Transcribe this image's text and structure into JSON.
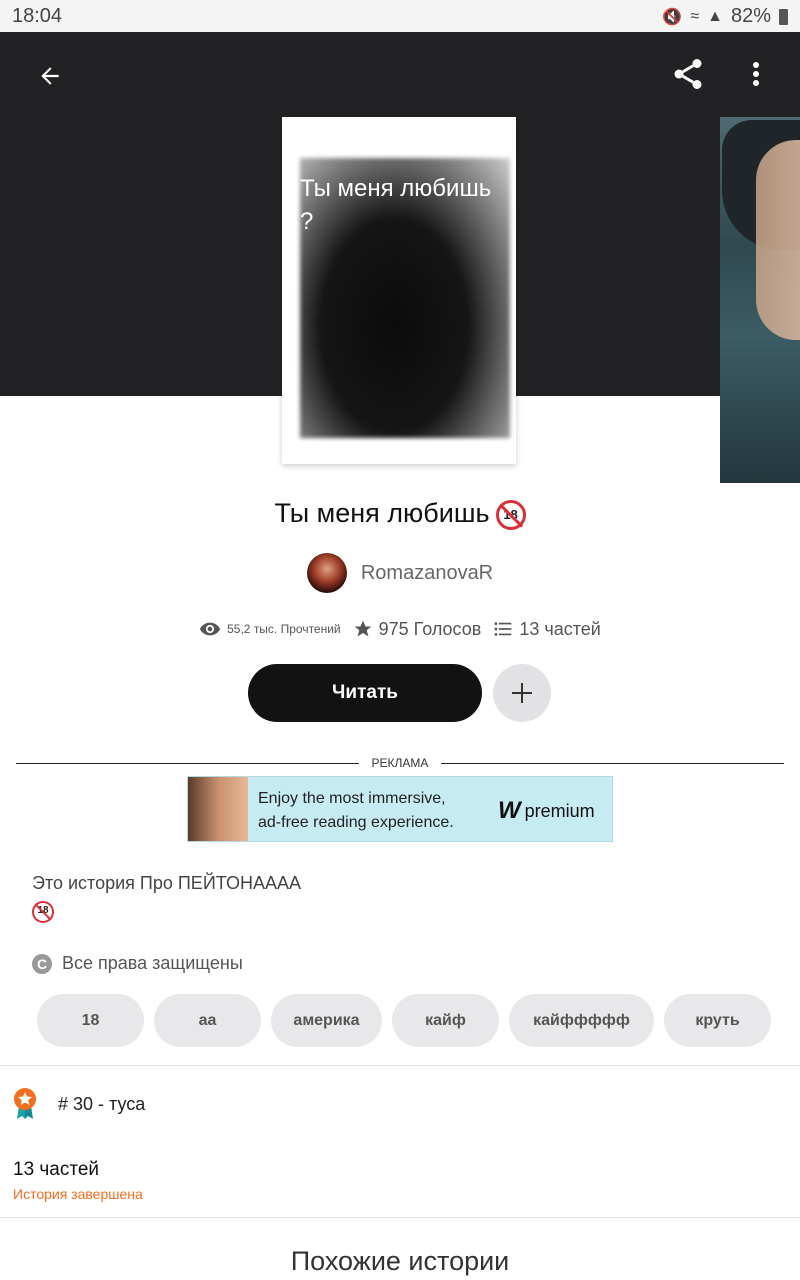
{
  "status_bar": {
    "time": "18:04",
    "battery": "82%"
  },
  "toolbar": {
    "back_icon": "back-arrow-icon",
    "share_icon": "share-icon",
    "more_icon": "more-vert-icon"
  },
  "cover": {
    "text": "Ты меня любишь ?"
  },
  "story": {
    "title": "Ты меня любишь",
    "age_badge": "18",
    "author": "RomazanovaR",
    "reads": "55,2 тыс. Прочтений",
    "votes": "975 Голосов",
    "parts": "13 частей",
    "read_button": "Читать"
  },
  "ad": {
    "label": "РЕКЛАМА",
    "line1": "Enjoy the most immersive,",
    "line2": "ad-free reading experience.",
    "logo_text": "premium",
    "logo_mark": "W"
  },
  "description": {
    "text": "Это история Про ПЕЙТОНАААА",
    "badge": "18"
  },
  "rights": {
    "icon": "copyright-icon",
    "text": "Все права защищены"
  },
  "tags": [
    "18",
    "аа",
    "америка",
    "кайф",
    "кайффффф",
    "круть"
  ],
  "ranking": {
    "text": "# 30 - туса"
  },
  "parts_section": {
    "title": "13 частей",
    "status": "История завершена"
  },
  "similar": {
    "title": "Похожие истории"
  },
  "colors": {
    "accent": "#f16f1e",
    "header_bg": "#222123",
    "button_dark": "#121212",
    "badge_red": "#d7313a"
  }
}
